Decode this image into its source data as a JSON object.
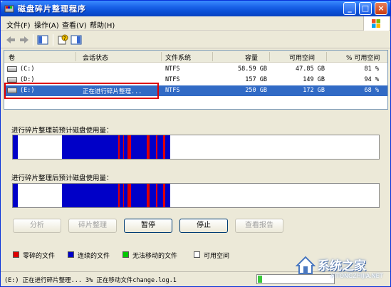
{
  "window": {
    "title": "磁盘碎片整理程序",
    "minimize_glyph": "_",
    "maximize_glyph": "□",
    "close_glyph": "×"
  },
  "menu": {
    "items": [
      {
        "label": "文件(F)"
      },
      {
        "label": "操作(A)"
      },
      {
        "label": "查看(V)"
      },
      {
        "label": "帮助(H)"
      }
    ]
  },
  "toolbar": {
    "icons": [
      "back-arrow-icon",
      "forward-arrow-icon",
      "properties-icon",
      "help-icon",
      "show-hide-icon"
    ]
  },
  "volume_list": {
    "columns": [
      "卷",
      "会话状态",
      "文件系统",
      "容量",
      "可用空间",
      "% 可用空间"
    ],
    "rows": [
      {
        "volume": "(C:)",
        "status": "",
        "fs": "NTFS",
        "capacity": "58.59 GB",
        "free": "47.85 GB",
        "pct": "81 %",
        "selected": false
      },
      {
        "volume": "(D:)",
        "status": "",
        "fs": "NTFS",
        "capacity": "157 GB",
        "free": "149 GB",
        "pct": "94 %",
        "selected": false
      },
      {
        "volume": "(E:)",
        "status": "正在进行碎片整理...",
        "fs": "NTFS",
        "capacity": "250 GB",
        "free": "172 GB",
        "pct": "68 %",
        "selected": true
      }
    ]
  },
  "analysis": {
    "before_label": "进行碎片整理前预计磁盘使用量：",
    "after_label": "进行碎片整理后预计磁盘使用量："
  },
  "buttons": {
    "analyze": "分析",
    "defragment": "碎片整理",
    "pause": "暂停",
    "stop": "停止",
    "view_report": "查看报告"
  },
  "legend": {
    "items": [
      {
        "label": "零碎的文件",
        "color": "#e00000"
      },
      {
        "label": "连续的文件",
        "color": "#0000c8"
      },
      {
        "label": "无法移动的文件",
        "color": "#00c800"
      },
      {
        "label": "可用空间",
        "color": "#ffffff"
      }
    ]
  },
  "status": {
    "text": "(E:) 正在进行碎片整理...  3%  正在移动文件change.log.1",
    "progress_fraction": 0.03
  },
  "colors": {
    "fragmented": "#e00000",
    "contiguous": "#0000c8",
    "unmovable": "#00c800",
    "free": "#ffffff",
    "selection": "#316ac5"
  },
  "watermark": {
    "text": "系统之家",
    "url": "XITONGZHIJIA.NET"
  }
}
